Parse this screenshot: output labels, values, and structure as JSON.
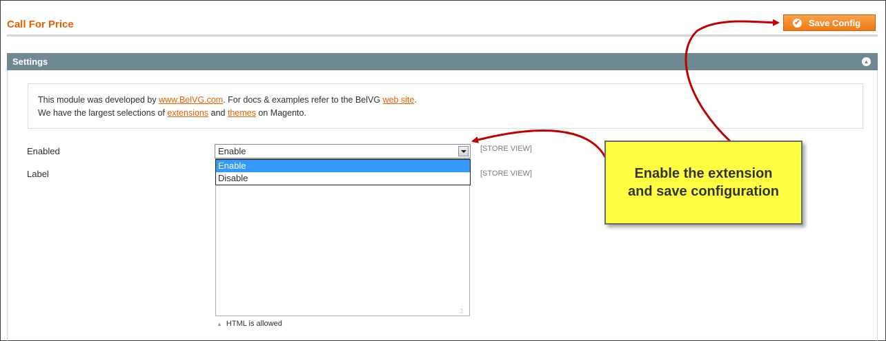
{
  "header": {
    "title": "Call For Price",
    "save_label": "Save Config"
  },
  "section": {
    "title": "Settings",
    "info": {
      "line1_prefix": "This module was developed by ",
      "link_belvg": "www.BelVG.com",
      "line1_mid": ". For docs & examples refer to the BelVG ",
      "link_website": "web site",
      "line1_end": ".",
      "line2_prefix": "We have the largest selections of ",
      "link_extensions": "extensions",
      "line2_and": " and ",
      "link_themes": "themes",
      "line2_end": " on Magento."
    },
    "fields": {
      "enabled": {
        "label": "Enabled",
        "value": "Enable",
        "scope": "[STORE VIEW]",
        "options": [
          "Enable",
          "Disable"
        ]
      },
      "label": {
        "label": "Label",
        "scope": "[STORE VIEW]",
        "hint": "HTML is allowed"
      }
    }
  },
  "callout": {
    "text": "Enable the extension and save configuration"
  },
  "colors": {
    "accent": "#eb5e00",
    "button": "#ef7a12",
    "section_header": "#6f8992",
    "callout_bg": "#ffff42",
    "arrow": "#c00000"
  }
}
